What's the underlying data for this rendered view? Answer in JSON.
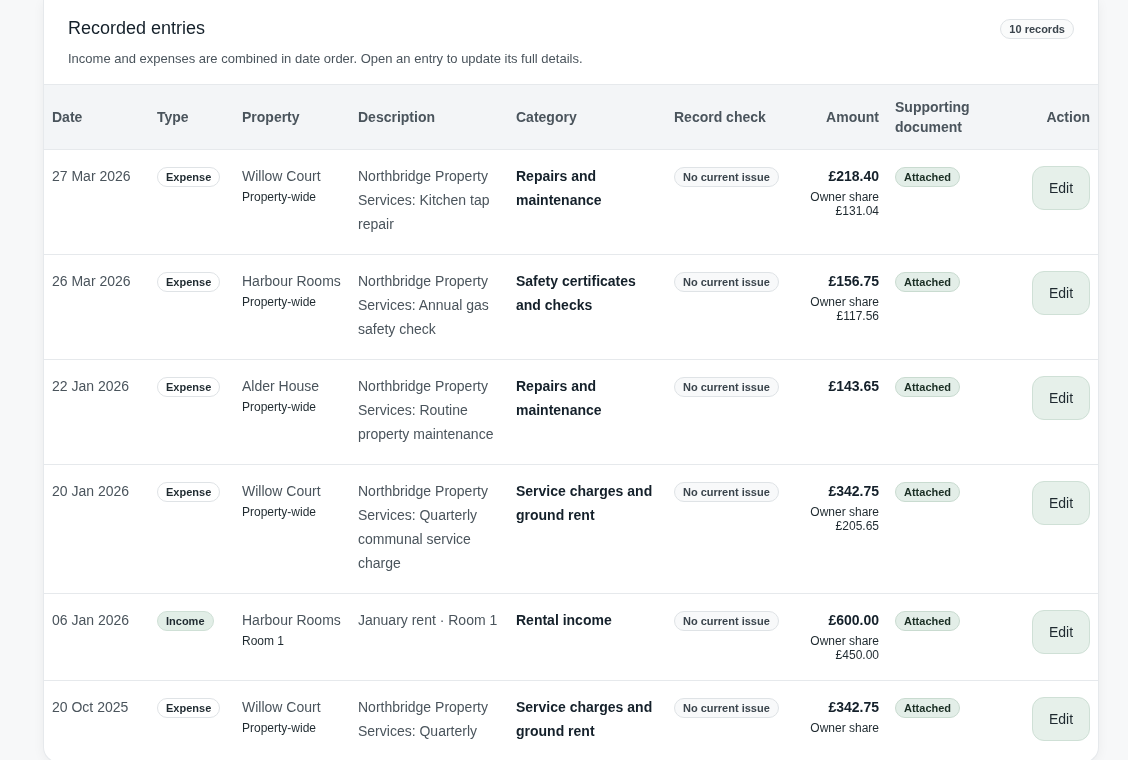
{
  "header": {
    "title": "Recorded entries",
    "count": "10 records",
    "subtitle": "Income and expenses are combined in date order. Open an entry to update its full details."
  },
  "columns": [
    "Date",
    "Type",
    "Property",
    "Description",
    "Category",
    "Record check",
    "Amount",
    "Supporting document",
    "Action"
  ],
  "rows": [
    {
      "date": "27 Mar 2026",
      "type": {
        "label": "Expense",
        "kind": "expense"
      },
      "property": "Willow Court",
      "unit": "Property-wide",
      "description": "Northbridge Property Services: Kitchen tap repair",
      "category": "Repairs and maintenance",
      "check": "No current issue",
      "amount": "£218.40",
      "share_label": "Owner share",
      "share_amount": "£131.04",
      "document": "Attached",
      "action": "Edit"
    },
    {
      "date": "26 Mar 2026",
      "type": {
        "label": "Expense",
        "kind": "expense"
      },
      "property": "Harbour Rooms",
      "unit": "Property-wide",
      "description": "Northbridge Property Services: Annual gas safety check",
      "category": "Safety certificates and checks",
      "check": "No current issue",
      "amount": "£156.75",
      "share_label": "Owner share",
      "share_amount": "£117.56",
      "document": "Attached",
      "action": "Edit"
    },
    {
      "date": "22 Jan 2026",
      "type": {
        "label": "Expense",
        "kind": "expense"
      },
      "property": "Alder House",
      "unit": "Property-wide",
      "description": "Northbridge Property Services: Routine property maintenance",
      "category": "Repairs and maintenance",
      "check": "No current issue",
      "amount": "£143.65",
      "document": "Attached",
      "action": "Edit"
    },
    {
      "date": "20 Jan 2026",
      "type": {
        "label": "Expense",
        "kind": "expense"
      },
      "property": "Willow Court",
      "unit": "Property-wide",
      "description": "Northbridge Property Services: Quarterly communal service charge",
      "category": "Service charges and ground rent",
      "check": "No current issue",
      "amount": "£342.75",
      "share_label": "Owner share",
      "share_amount": "£205.65",
      "document": "Attached",
      "action": "Edit"
    },
    {
      "date": "06 Jan 2026",
      "type": {
        "label": "Income",
        "kind": "income"
      },
      "property": "Harbour Rooms",
      "unit": "Room 1",
      "description": "January rent · Room 1",
      "category": "Rental income",
      "check": "No current issue",
      "amount": "£600.00",
      "share_label": "Owner share",
      "share_amount": "£450.00",
      "document": "Attached",
      "action": "Edit"
    },
    {
      "date": "20 Oct 2025",
      "type": {
        "label": "Expense",
        "kind": "expense"
      },
      "property": "Willow Court",
      "unit": "Property-wide",
      "description": "Northbridge Property Services: Quarterly",
      "category": "Service charges and ground rent",
      "check": "No current issue",
      "amount": "£342.75",
      "share_label": "Owner share",
      "document": "Attached",
      "action": "Edit"
    }
  ]
}
